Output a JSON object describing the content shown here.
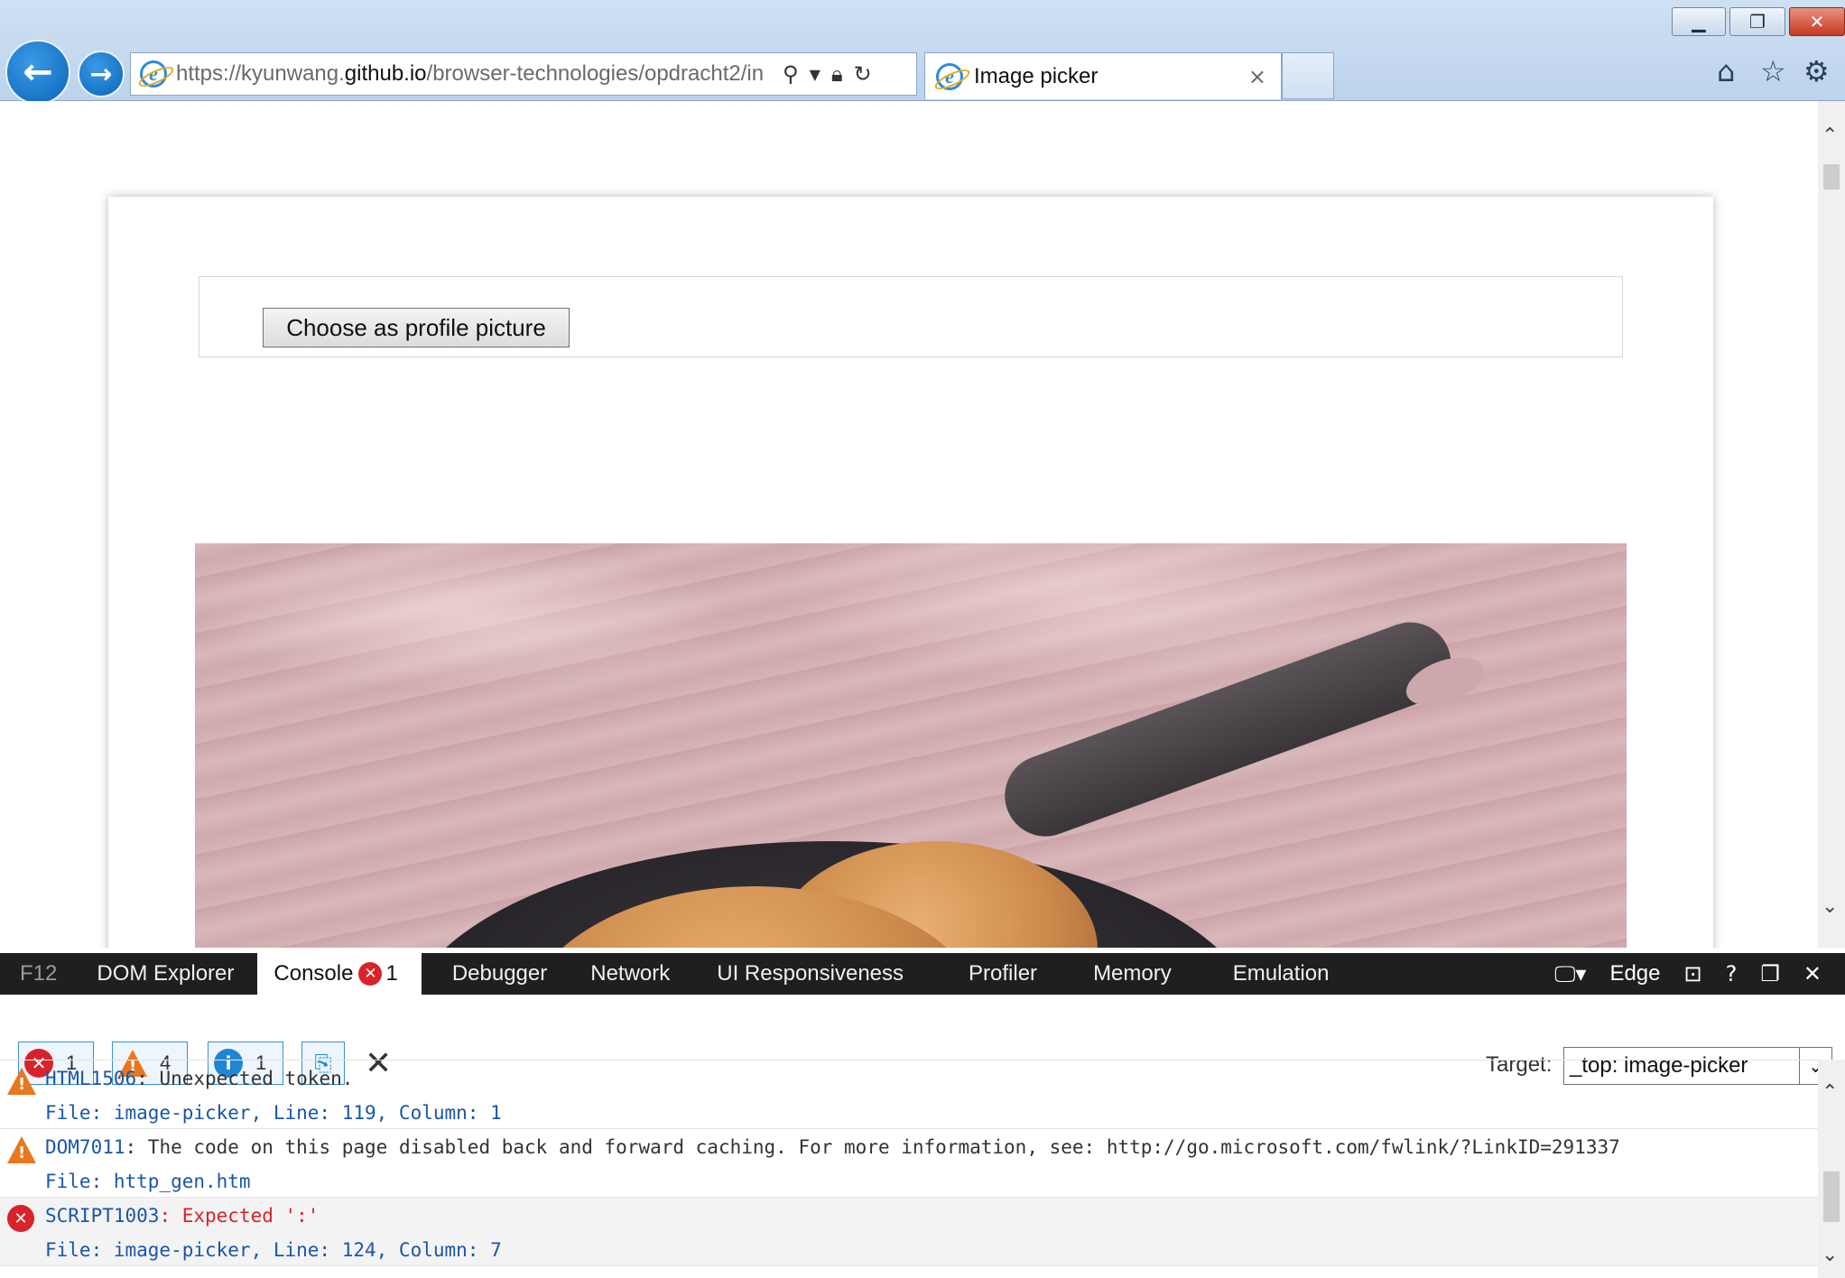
{
  "window": {
    "minimize_icon": "minimize-icon",
    "restore_icon": "restore-icon",
    "close_icon": "close-icon"
  },
  "browser": {
    "url_prefix": "https://kyunwang.",
    "url_domain": "github.io",
    "url_rest": "/browser-technologies/opdracht2/in",
    "tab_title": "Image picker",
    "tab_close": "×"
  },
  "page": {
    "choose_button_label": "Choose as profile picture"
  },
  "devtools": {
    "tabs": [
      {
        "label": "F12"
      },
      {
        "label": "DOM Explorer"
      },
      {
        "label": "Console",
        "error_count": "1"
      },
      {
        "label": "Debugger"
      },
      {
        "label": "Network"
      },
      {
        "label": "UI Responsiveness"
      },
      {
        "label": "Profiler"
      },
      {
        "label": "Memory"
      },
      {
        "label": "Emulation"
      }
    ],
    "document_mode": "Edge",
    "filters": {
      "errors": "1",
      "warnings": "4",
      "info": "1"
    },
    "target_label": "Target:",
    "target_value": "_top: image-picker",
    "messages": [
      {
        "level": "warning",
        "code": "HTML1506",
        "text": ": Unexpected token.",
        "file": "File: image-picker, Line: 119, Column: 1"
      },
      {
        "level": "warning",
        "code": "DOM7011",
        "text": ": The code on this page disabled back and forward caching. For more information, see: http://go.microsoft.com/fwlink/?LinkID=291337",
        "file": "File: http_gen.htm"
      },
      {
        "level": "error",
        "code": "SCRIPT1003",
        "text": ": Expected ':'",
        "file": "File: image-picker, Line: 124, Column: 7"
      }
    ]
  },
  "colors": {
    "error": "#d8232a",
    "warning": "#e7781e",
    "info": "#1f86d6",
    "devtools_bar": "#1f1f1f"
  }
}
